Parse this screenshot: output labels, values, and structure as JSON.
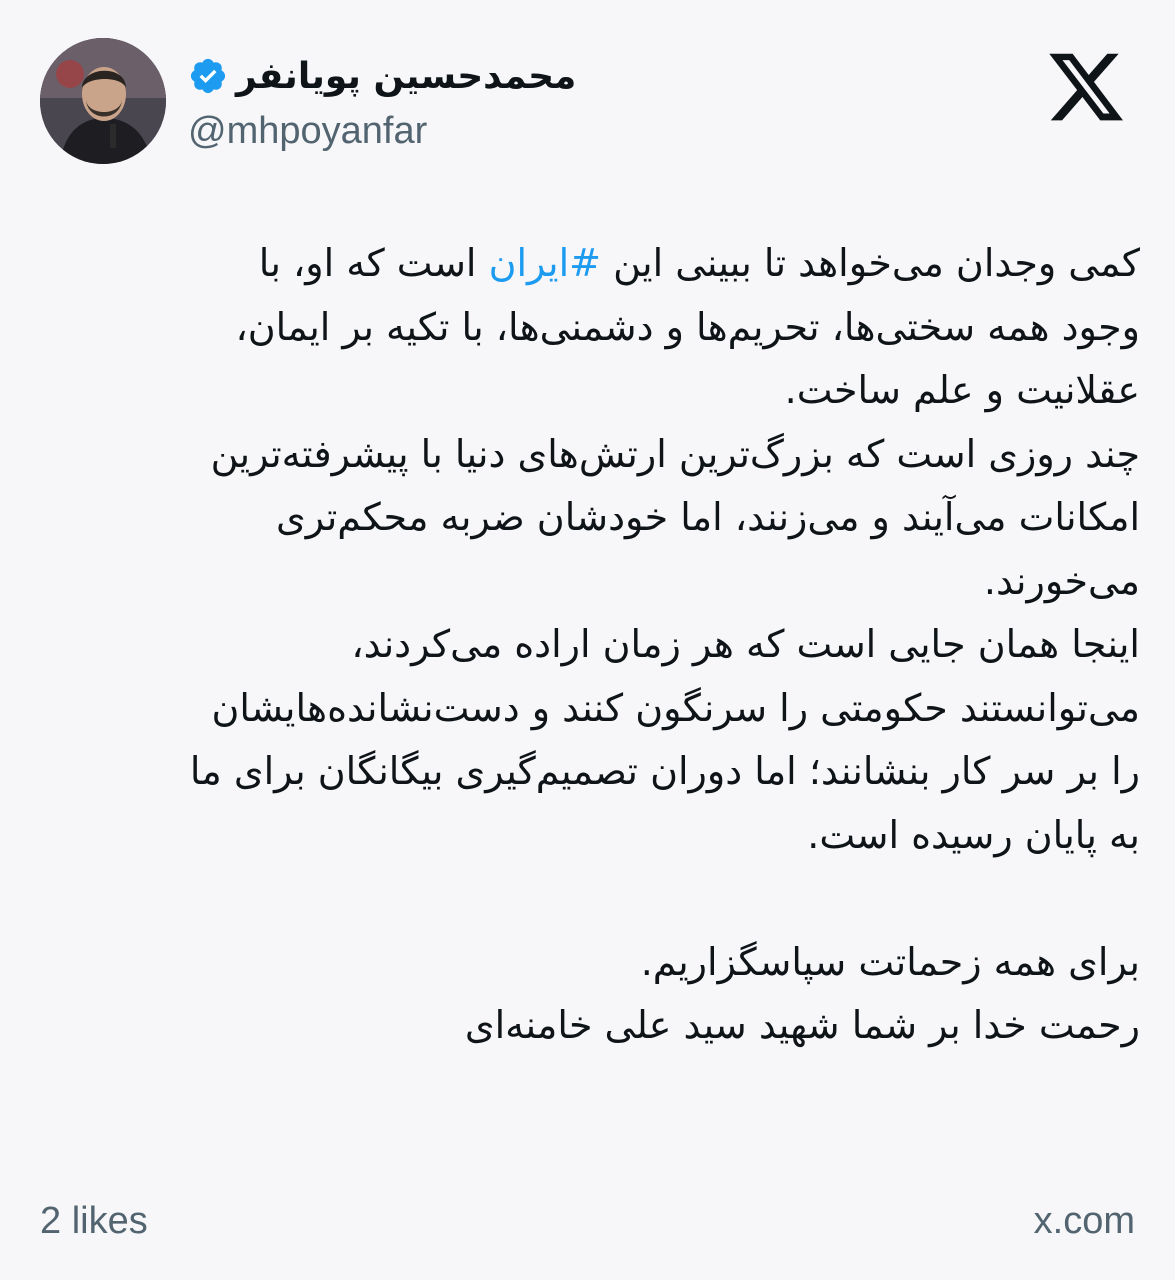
{
  "header": {
    "display_name": "محمدحسین پویانفر",
    "handle": "@mhpoyanfar",
    "avatar_icon": "avatar-photo",
    "verified_icon": "verified-badge-icon",
    "brand_icon": "x-logo-icon",
    "verified_color": "#1d9bf0"
  },
  "tweet": {
    "line1_before": "کمی وجدان می‌خواهد تا ببینی این ",
    "line1_hashtag": "#ایران",
    "line1_after": " است که او، با",
    "line2": "وجود همه سختی‌ها، تحریم‌ها و دشمنی‌ها، با تکیه بر ایمان،",
    "line3": "عقلانیت و علم ساخت.",
    "line4": "چند روزی است که بزرگ‌ترین ارتش‌های دنیا با پیشرفته‌ترین",
    "line5": "امکانات می‌آیند و می‌زنند، اما خودشان ضربه محکم‌تری",
    "line6": "می‌خورند.",
    "line7": "اینجا همان جایی است که هر زمان اراده می‌کردند،",
    "line8": "می‌توانستند حکومتی را سرنگون کنند و دست‌نشانده‌هایشان",
    "line9": "را بر سر کار بنشانند؛ اما دوران تصمیم‌گیری بیگانگان برای ما",
    "line10": "به پایان رسیده است.",
    "line11": "برای همه زحماتت سپاسگزاریم.",
    "line12": "رحمت خدا بر شما  شهید سید علی خامنه‌ای",
    "hashtag_color": "#1d9bf0"
  },
  "footer": {
    "likes": "2 likes",
    "domain": "x.com"
  }
}
